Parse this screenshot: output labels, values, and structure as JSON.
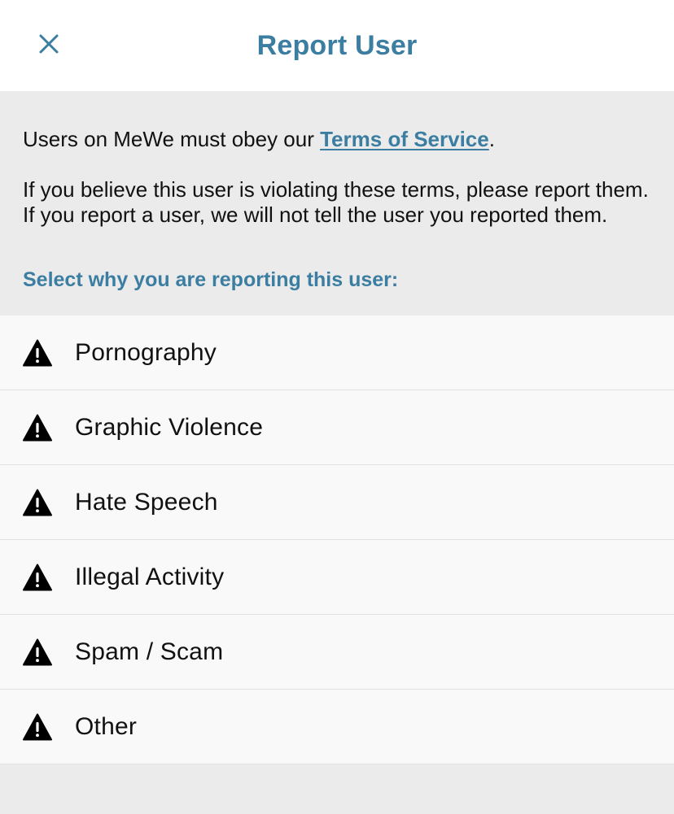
{
  "header": {
    "title": "Report User",
    "close_icon": "close-icon"
  },
  "intro": {
    "line1_prefix": "Users on MeWe must obey our ",
    "tos_link": "Terms of Service",
    "line1_suffix": ".",
    "paragraph2": "If you believe this user is violating these terms, please report them. If you report a user, we will not tell the user you reported them."
  },
  "section": {
    "prompt": "Select why you are reporting this user:"
  },
  "reasons": [
    {
      "label": "Pornography",
      "icon": "warning-icon"
    },
    {
      "label": "Graphic Violence",
      "icon": "warning-icon"
    },
    {
      "label": "Hate Speech",
      "icon": "warning-icon"
    },
    {
      "label": "Illegal Activity",
      "icon": "warning-icon"
    },
    {
      "label": "Spam / Scam",
      "icon": "warning-icon"
    },
    {
      "label": "Other",
      "icon": "warning-icon"
    }
  ],
  "colors": {
    "accent": "#3b7ea1",
    "background": "#ebebeb",
    "list_background": "#f9f9f9",
    "text": "#111111"
  }
}
